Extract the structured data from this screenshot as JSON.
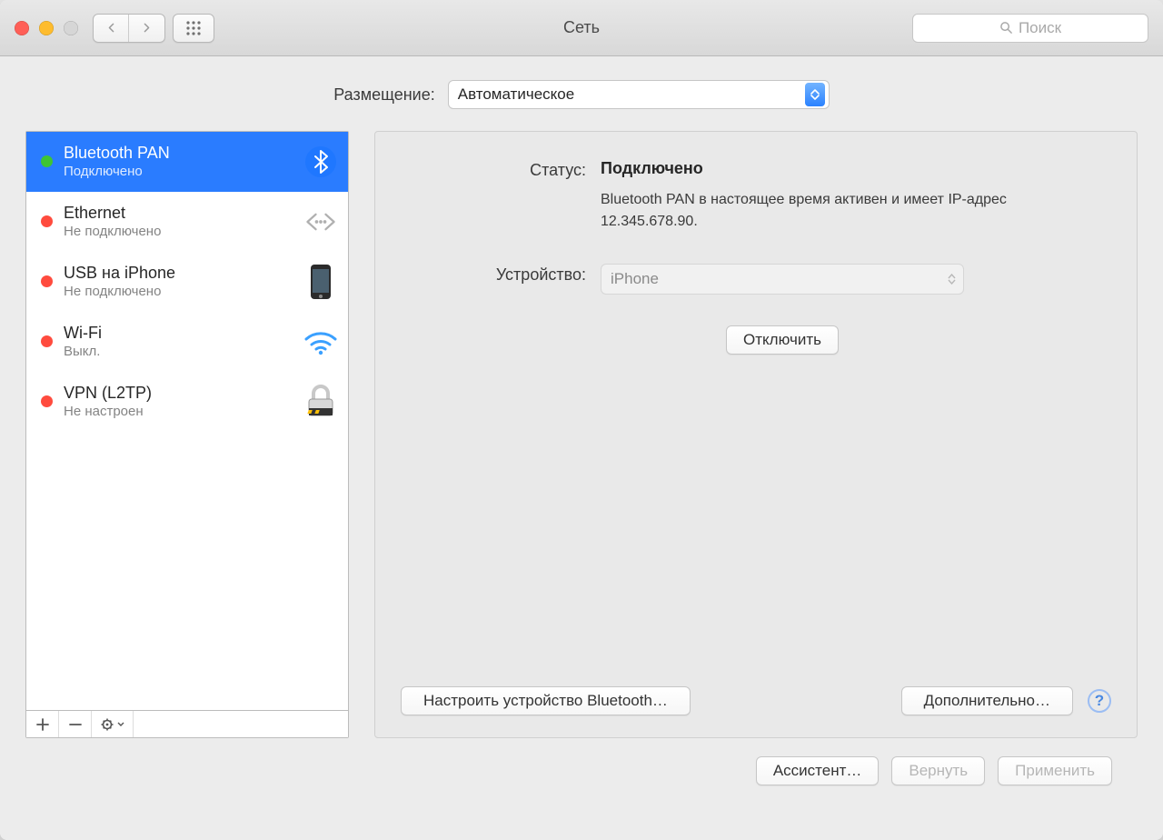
{
  "window": {
    "title": "Сеть"
  },
  "search": {
    "placeholder": "Поиск"
  },
  "location": {
    "label": "Размещение:",
    "value": "Автоматическое"
  },
  "services": [
    {
      "name": "Bluetooth PAN",
      "status": "Подключено",
      "dot": "grn",
      "icon": "bluetooth",
      "selected": true
    },
    {
      "name": "Ethernet",
      "status": "Не подключено",
      "dot": "red",
      "icon": "ethernet",
      "selected": false
    },
    {
      "name": "USB на iPhone",
      "status": "Не подключено",
      "dot": "red",
      "icon": "iphone",
      "selected": false
    },
    {
      "name": "Wi-Fi",
      "status": "Выкл.",
      "dot": "red",
      "icon": "wifi",
      "selected": false
    },
    {
      "name": "VPN (L2TP)",
      "status": "Не настроен",
      "dot": "red",
      "icon": "lock",
      "selected": false
    }
  ],
  "detail": {
    "status_label": "Статус:",
    "status_value": "Подключено",
    "status_sub": "Bluetooth PAN в настоящее время активен и имеет IP-адрес 12.345.678.90.",
    "device_label": "Устройство:",
    "device_value": "iPhone",
    "disconnect": "Отключить",
    "configure_bt": "Настроить устройство Bluetooth…",
    "advanced": "Дополнительно…"
  },
  "footer": {
    "assist": "Ассистент…",
    "revert": "Вернуть",
    "apply": "Применить"
  }
}
